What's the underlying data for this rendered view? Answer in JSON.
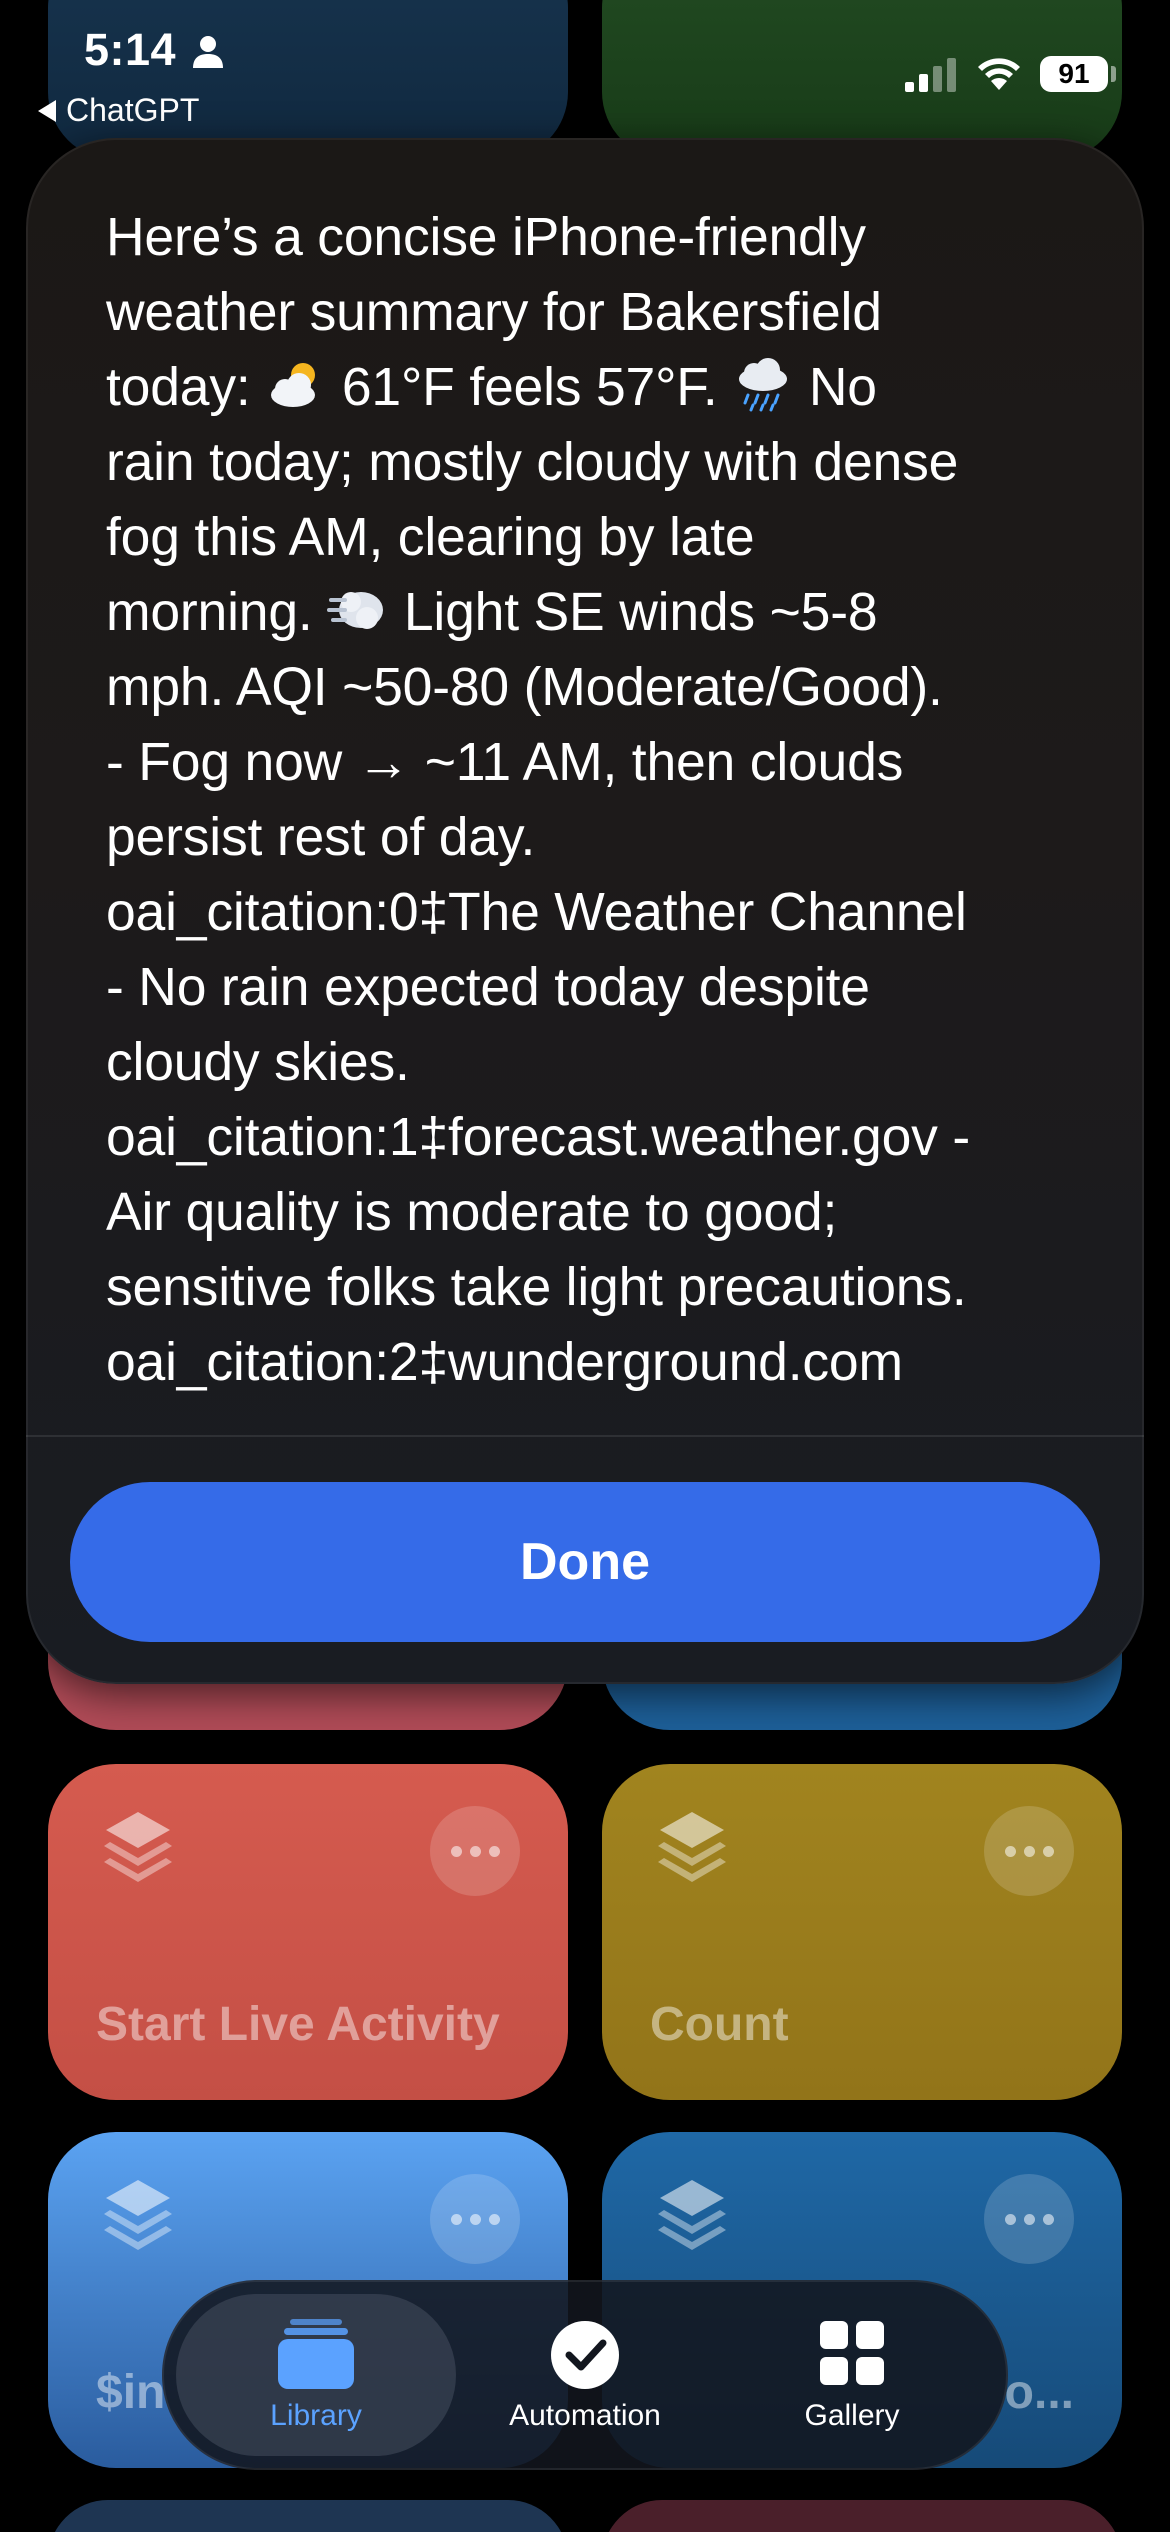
{
  "status_bar": {
    "time": "5:14",
    "back_app": "ChatGPT",
    "battery": "91"
  },
  "modal": {
    "lines": [
      "Here’s a concise iPhone-friendly",
      "weather summary for Bakersfield",
      "today: {sun_cloud} 61°F feels 57°F. {rain_cloud} No",
      "rain today; mostly cloudy with dense",
      "fog this AM, clearing by late",
      "morning. {wind} Light SE winds ~5-8",
      "mph. AQI ~50-80 (Moderate/Good).",
      "- Fog now → ~11 AM, then clouds",
      "persist rest of day.",
      "oai_citation:0‡The Weather Channel",
      "- No rain expected today despite",
      "cloudy skies.",
      "oai_citation:1‡forecast.weather.gov -",
      "Air quality is moderate to good;",
      "sensitive folks take light precautions.",
      "oai_citation:2‡wunderground.com"
    ],
    "text": {
      "l1": "Here’s a concise iPhone-friendly",
      "l2": "weather summary for Bakersfield",
      "l3a": "today: ",
      "l3b": " 61°F feels 57°F. ",
      "l3c": " No",
      "l4": "rain today; mostly cloudy with dense",
      "l5": "fog this AM, clearing by late",
      "l6a": "morning. ",
      "l6b": " Light SE winds ~5-8",
      "l7": "mph. AQI ~50-80 (Moderate/Good).",
      "l8": "- Fog now → ~11 AM, then clouds",
      "l9": "persist rest of day.",
      "l10": "oai_citation:0‡The Weather Channel",
      "l11": "- No rain expected today despite",
      "l12": "cloudy skies.",
      "l13": "oai_citation:1‡forecast.weather.gov -",
      "l14": "Air quality is moderate to good;",
      "l15": "sensitive folks take light precautions.",
      "l16": "oai_citation:2‡wunderground.com"
    },
    "emoji_icons": [
      "sun-behind-cloud-icon",
      "cloud-with-rain-icon",
      "wind-face-icon"
    ],
    "done_label": "Done"
  },
  "tiles": [
    {
      "label": "",
      "color": "#c8515c"
    },
    {
      "label": "",
      "color": "#1f6aa8"
    },
    {
      "label": "Start Live Activity",
      "color": "#d45a4c"
    },
    {
      "label": "Count",
      "color": "#9b7f1e"
    },
    {
      "label": "$in",
      "color": "#4d93e6"
    },
    {
      "label": "o...",
      "color": "#1c5a8e"
    }
  ],
  "tab_bar": {
    "tabs": [
      {
        "label": "Library",
        "icon": "folder-stack-icon",
        "active": true
      },
      {
        "label": "Automation",
        "icon": "clock-check-icon",
        "active": false
      },
      {
        "label": "Gallery",
        "icon": "grid-icon",
        "active": false
      }
    ]
  },
  "colors": {
    "accent": "#356be8",
    "active_tab": "#5ba2ff"
  }
}
